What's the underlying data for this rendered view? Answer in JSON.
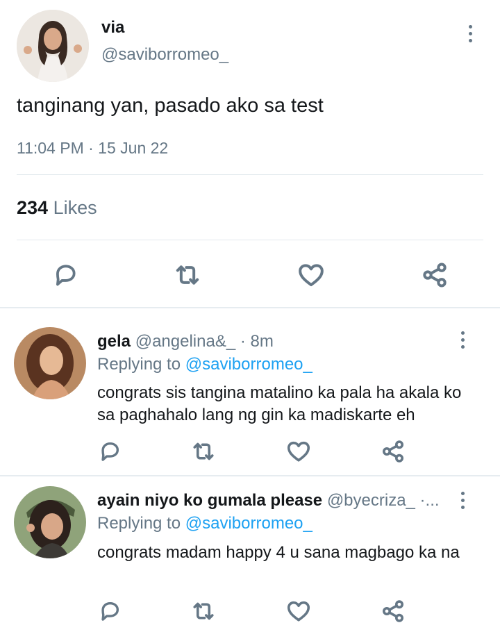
{
  "tweet": {
    "display_name": "via",
    "handle": "@saviborromeo_",
    "text": "tanginang yan, pasado ako sa test",
    "timestamp": "11:04 PM · 15 Jun 22",
    "likes_count": "234",
    "likes_label": "Likes",
    "actions": [
      "reply-icon",
      "retweet-icon",
      "like-icon",
      "share-icon"
    ]
  },
  "replies": [
    {
      "display_name": "gela",
      "handle": "@angelina&_",
      "time": "· 8m",
      "replying_prefix": "Replying to",
      "replying_to": "@saviborromeo_",
      "text": "congrats sis tangina matalino ka pala ha akala ko sa paghahalo lang ng gin ka madiskarte eh"
    },
    {
      "display_name": "ayain niyo ko gumala please",
      "handle": "@byecriza_ ·...",
      "replying_prefix": "Replying to",
      "replying_to": "@saviborromeo_",
      "text": "congrats madam happy 4 u sana magbago ka na"
    }
  ],
  "colors": {
    "accent": "#1da1f2",
    "muted": "#657786",
    "text": "#14171a",
    "divider": "#e1e8ed"
  }
}
